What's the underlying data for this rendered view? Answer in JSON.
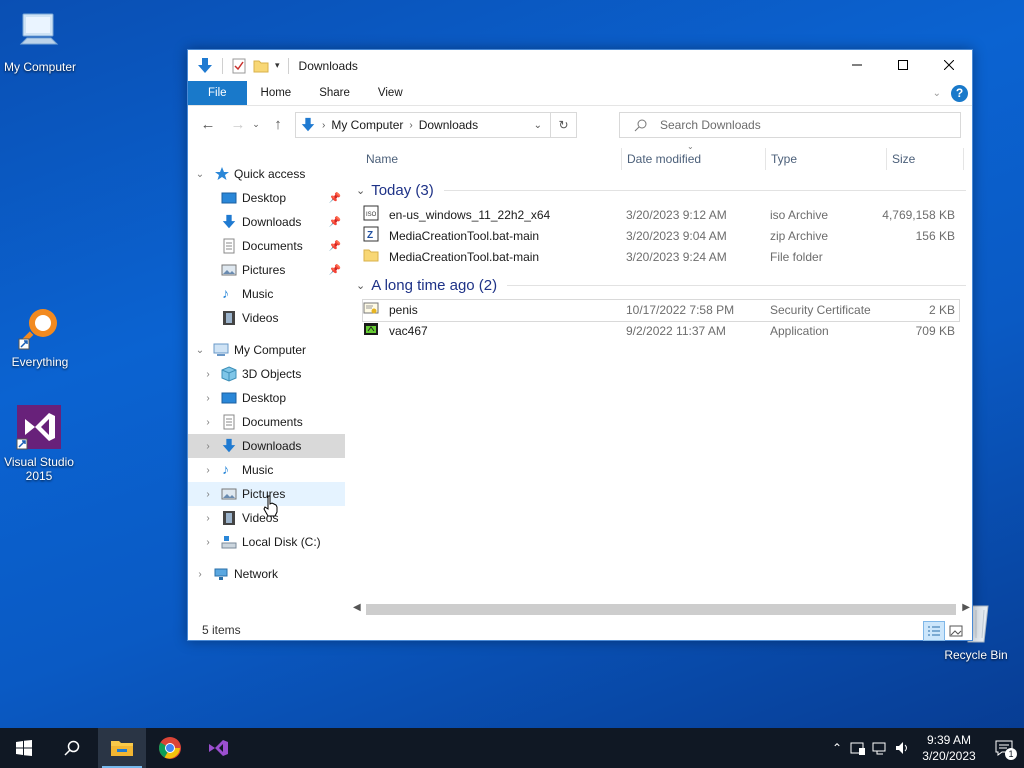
{
  "desktop": {
    "icons": [
      {
        "label": "My Computer"
      },
      {
        "label": "Everything"
      },
      {
        "label": "Visual Studio 2015"
      },
      {
        "label": "Recycle Bin"
      }
    ]
  },
  "window": {
    "title": "Downloads",
    "ribbon_tabs": [
      "File",
      "Home",
      "Share",
      "View"
    ],
    "address": {
      "crumbs": [
        "My Computer",
        "Downloads"
      ]
    },
    "search_placeholder": "Search Downloads",
    "status": "5 items"
  },
  "navpane": {
    "quick_access": "Quick access",
    "quick_items": [
      "Desktop",
      "Downloads",
      "Documents",
      "Pictures",
      "Music",
      "Videos"
    ],
    "my_computer": "My Computer",
    "computer_items": [
      "3D Objects",
      "Desktop",
      "Documents",
      "Downloads",
      "Music",
      "Pictures",
      "Videos",
      "Local Disk (C:)"
    ],
    "network": "Network"
  },
  "columns": {
    "name": "Name",
    "date": "Date modified",
    "type": "Type",
    "size": "Size"
  },
  "groups": [
    {
      "label": "Today (3)",
      "files": [
        {
          "name": "en-us_windows_11_22h2_x64",
          "date": "3/20/2023 9:12 AM",
          "type": "iso Archive",
          "size": "4,769,158 KB",
          "icon": "iso-icon"
        },
        {
          "name": "MediaCreationTool.bat-main",
          "date": "3/20/2023 9:04 AM",
          "type": "zip Archive",
          "size": "156 KB",
          "icon": "zip-icon"
        },
        {
          "name": "MediaCreationTool.bat-main",
          "date": "3/20/2023 9:24 AM",
          "type": "File folder",
          "size": "",
          "icon": "folder-icon"
        }
      ]
    },
    {
      "label": "A long time ago (2)",
      "files": [
        {
          "name": "penis",
          "date": "10/17/2022 7:58 PM",
          "type": "Security Certificate",
          "size": "2 KB",
          "icon": "certificate-icon"
        },
        {
          "name": "vac467",
          "date": "9/2/2022 11:37 AM",
          "type": "Application",
          "size": "709 KB",
          "icon": "application-icon"
        }
      ]
    }
  ],
  "taskbar": {
    "time": "9:39 AM",
    "date": "3/20/2023",
    "notifications": "1"
  }
}
